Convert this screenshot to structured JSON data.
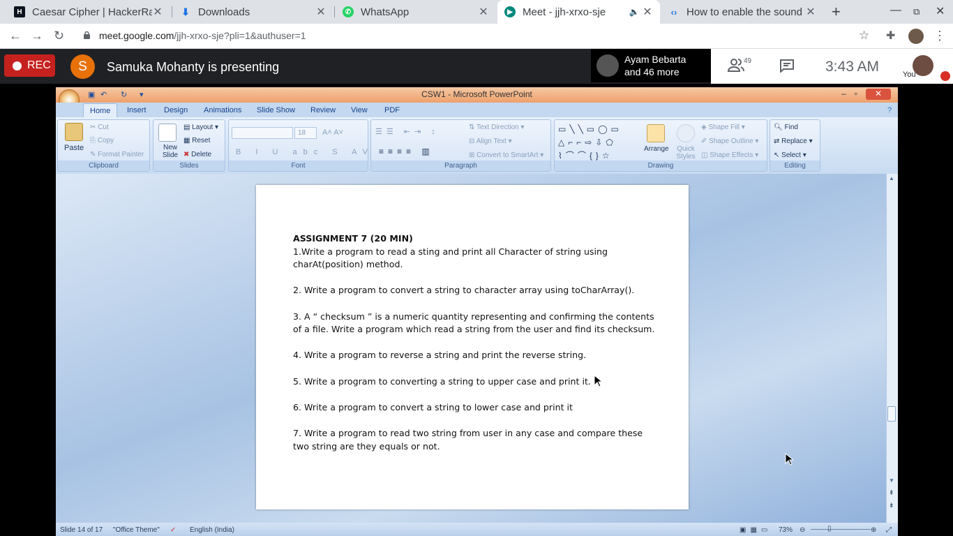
{
  "browser": {
    "tabs": [
      {
        "title": "Caesar Cipher | HackerRank",
        "favicon": "hackerrank-icon",
        "active": false
      },
      {
        "title": "Downloads",
        "favicon": "download-icon",
        "active": false
      },
      {
        "title": "WhatsApp",
        "favicon": "whatsapp-icon",
        "active": false
      },
      {
        "title": "Meet - jjh-xrxo-sje",
        "favicon": "meet-icon",
        "active": true
      },
      {
        "title": "How to enable the sound",
        "favicon": "link-icon",
        "active": false
      }
    ],
    "url_host": "meet.google.com",
    "url_path": "/jjh-xrxo-sje?pli=1&authuser=1"
  },
  "meet": {
    "rec_label": "REC",
    "presenter_initial": "S",
    "presenting_text": "Samuka Mohanty is presenting",
    "participant_name": "Ayam Bebarta",
    "participant_more": "and 46 more",
    "people_count": "49",
    "clock": "3:43 AM",
    "you_label": "You",
    "colors": {
      "rec": "#c5221f",
      "avatar": "#e8710a"
    }
  },
  "ppt": {
    "window_title": "CSW1 - Microsoft PowerPoint",
    "ribbon_tabs": [
      "Home",
      "Insert",
      "Design",
      "Animations",
      "Slide Show",
      "Review",
      "View",
      "PDF"
    ],
    "groups": {
      "clipboard": {
        "label": "Clipboard",
        "paste": "Paste",
        "cut": "Cut",
        "copy": "Copy",
        "format_painter": "Format Painter"
      },
      "slides": {
        "label": "Slides",
        "new_slide": "New Slide",
        "layout": "Layout",
        "reset": "Reset",
        "delete": "Delete"
      },
      "font": {
        "label": "Font",
        "size": "18"
      },
      "paragraph": {
        "label": "Paragraph",
        "text_direction": "Text Direction",
        "align_text": "Align Text",
        "convert": "Convert to SmartArt"
      },
      "drawing": {
        "label": "Drawing",
        "arrange": "Arrange",
        "quick_styles": "Quick Styles",
        "shape_fill": "Shape Fill",
        "shape_outline": "Shape Outline",
        "shape_effects": "Shape Effects"
      },
      "editing": {
        "label": "Editing",
        "find": "Find",
        "replace": "Replace",
        "select": "Select"
      }
    },
    "slide": {
      "heading": "ASSIGNMENT 7 (20 MIN)",
      "items": [
        "1.Write a program to read a sting and print all Character of string using charAt(position) method.",
        "2. Write a program to convert a string to character array using toCharArray().",
        "3. A “ checksum ” is a numeric quantity representing and confirming the contents of a file. Write a program which read a string from the user and find its checksum.",
        "4. Write a program to reverse a string and print the reverse string.",
        "5. Write a program to converting a string to upper case and print it.",
        "6. Write a program to convert a string to lower case and print it",
        "7. Write a program to read two string from user in any case and compare these two string are they equals or not."
      ]
    },
    "status": {
      "slide_info": "Slide 14 of 17",
      "theme": "\"Office Theme\"",
      "language": "English (India)",
      "zoom": "73%"
    }
  }
}
